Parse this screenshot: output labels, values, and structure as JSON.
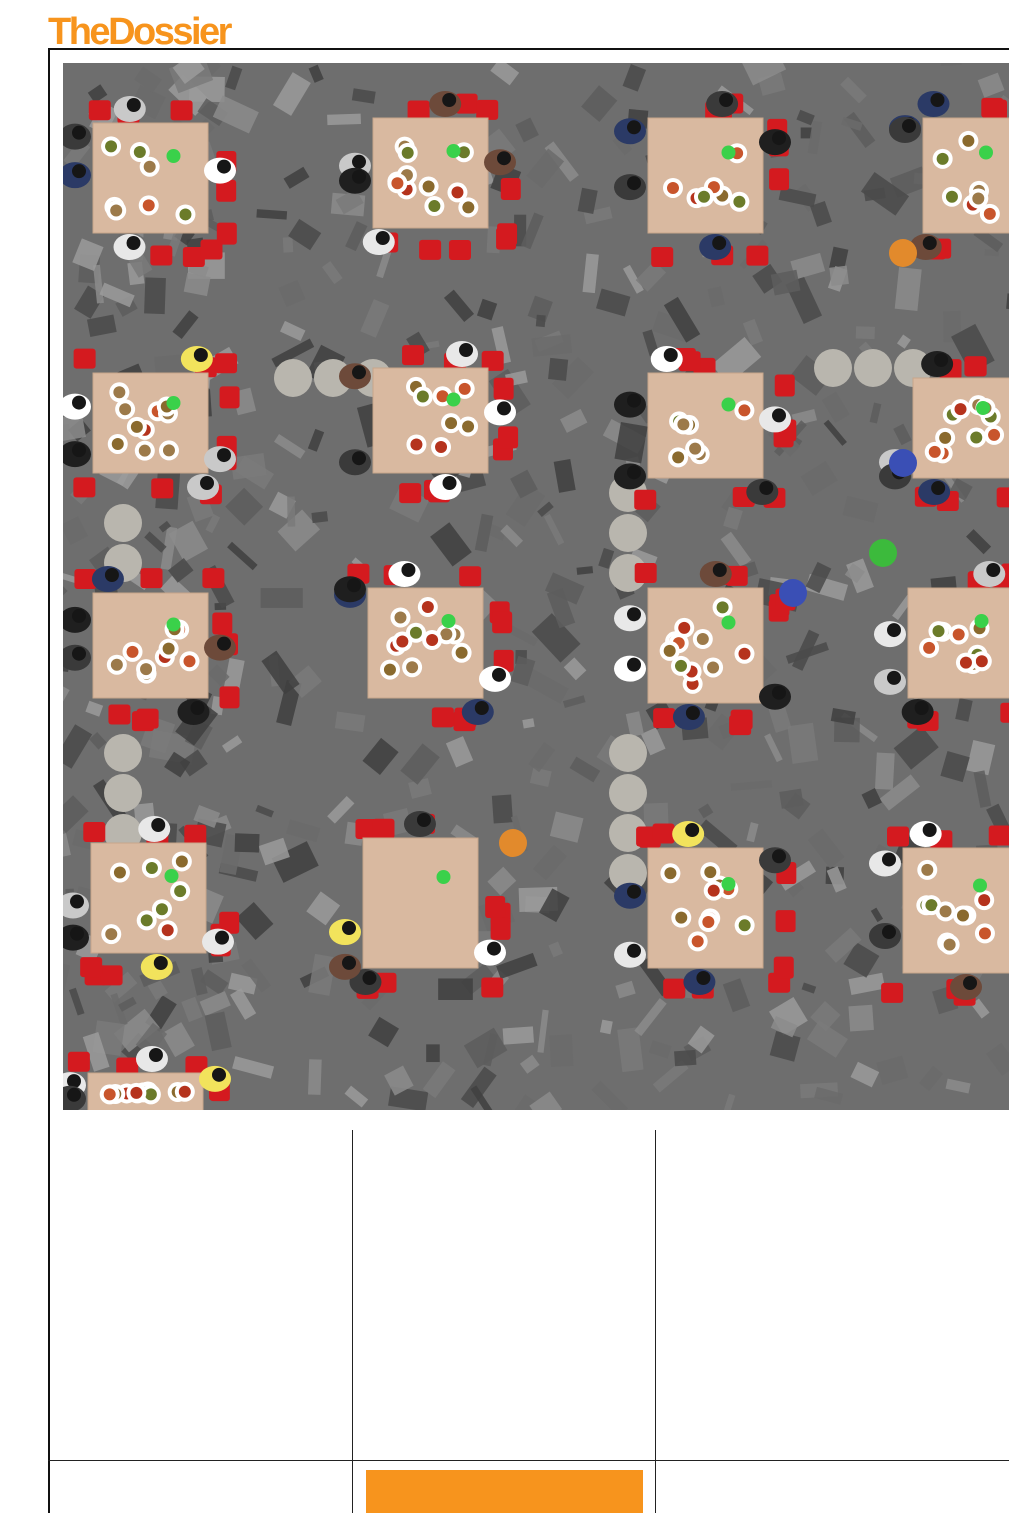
{
  "masthead": {
    "title_part1": "The",
    "title_part2": "Dossier"
  },
  "colors": {
    "brand_orange": "#f7941d",
    "rules": "#111111",
    "photo_floor": "#6e6e6e",
    "table_top": "#d9b9a0",
    "stool_red": "#d41a1f"
  },
  "photo": {
    "subject": "aerial-view-outdoor-banquet-tables"
  }
}
